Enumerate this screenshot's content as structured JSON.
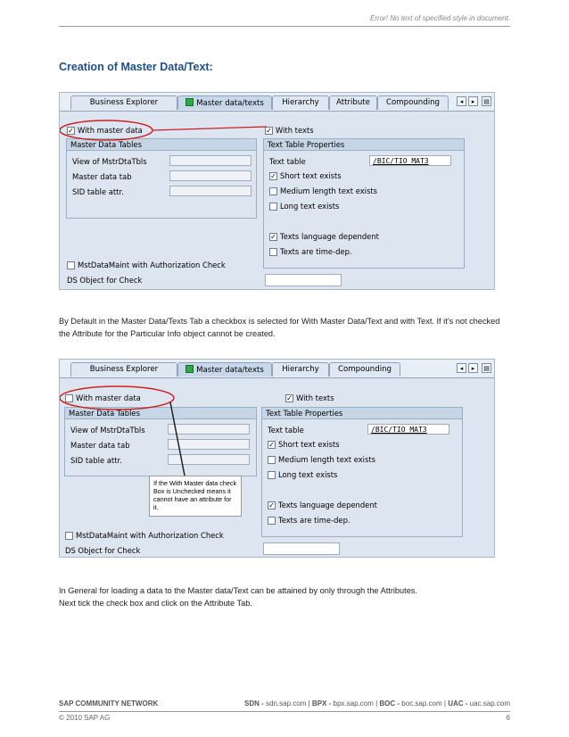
{
  "header": {
    "note": "Error! No text of specified style in document."
  },
  "title": "Creation of Master Data/Text:",
  "screen1": {
    "tabs": [
      "Business Explorer",
      "Master data/texts",
      "Hierarchy",
      "Attribute",
      "Compounding"
    ],
    "with_master_data": "With master data",
    "with_texts": "With texts",
    "master_group": {
      "title": "Master Data Tables",
      "rows": [
        "View of MstrDtaTbls",
        "Master data tab",
        "SID table attr."
      ]
    },
    "text_group": {
      "title": "Text Table Properties",
      "text_table_label": "Text table",
      "text_table_value": "/BIC/TIO_MAT3",
      "short": "Short text exists",
      "medium": "Medium length text exists",
      "long": "Long text exists",
      "lang": "Texts language dependent",
      "time": "Texts are time-dep."
    },
    "auth": "MstDataMaint with Authorization Check",
    "ds": "DS Object for Check"
  },
  "para1": "By Default in the Master Data/Texts Tab a checkbox is selected for With Master Data/Text and with Text. If it’s not checked the Attribute for the Particular Info object cannot be created.",
  "screen2": {
    "tabs": [
      "Business Explorer",
      "Master data/texts",
      "Hierarchy",
      "Compounding"
    ],
    "with_master_data": "With master data",
    "with_texts": "With texts",
    "master_group": {
      "title": "Master Data Tables",
      "rows": [
        "View of MstrDtaTbls",
        "Master data tab",
        "SID table attr."
      ]
    },
    "text_group": {
      "title": "Text Table Properties",
      "text_table_label": "Text table",
      "text_table_value": "/BIC/TIO_MAT3",
      "short": "Short text exists",
      "medium": "Medium length text exists",
      "long": "Long text exists",
      "lang": "Texts language dependent",
      "time": "Texts are time-dep."
    },
    "auth": "MstDataMaint with Authorization Check",
    "ds": "DS Object for Check",
    "callout": "If the With Master data check Box is Unchecked means it cannot have an attribute for it."
  },
  "para2_line1": "In General for loading a data to the Master data/Text can be attained by only through the Attributes.",
  "para2_line2": "Next tick the check box and click on the Attribute Tab.",
  "footer": {
    "network": "SAP COMMUNITY NETWORK",
    "sdn_label": "SDN -",
    "sdn": "sdn.sap.com",
    "bpx_label": "BPX -",
    "bpx": "bpx.sap.com",
    "boc_label": "BOC -",
    "boc": "boc.sap.com",
    "uac_label": "UAC -",
    "uac": "uac.sap.com",
    "copyright": "© 2010 SAP AG",
    "page": "6"
  },
  "colors": {
    "title": "#1f4f8a",
    "annotation": "#cc2020",
    "panel": "#dde6f0"
  }
}
